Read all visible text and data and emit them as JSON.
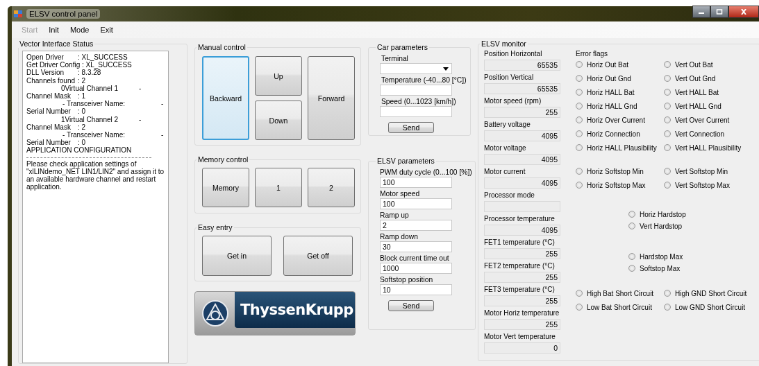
{
  "window": {
    "title": "ELSV control panel"
  },
  "menu": [
    {
      "label": "Start",
      "disabled": true
    },
    {
      "label": "Init",
      "disabled": false
    },
    {
      "label": "Mode",
      "disabled": false
    },
    {
      "label": "Exit",
      "disabled": false
    }
  ],
  "vector_status": {
    "title": "Vector Interface Status",
    "lines": [
      {
        "kind": "pair",
        "text": "Open Driver",
        "value": ": XL_SUCCESS"
      },
      {
        "kind": "plain",
        "text": "Get Driver Config : XL_SUCCESS"
      },
      {
        "kind": "pair",
        "text": "DLL Version",
        "value": ": 8.3.28"
      },
      {
        "kind": "pair",
        "text": "Channels found",
        "value": ": 2"
      },
      {
        "kind": "indented",
        "text": "0Virtual Channel 1",
        "tail": "-"
      },
      {
        "kind": "pair",
        "text": "Channel Mask",
        "value": ": 1"
      },
      {
        "kind": "indented2",
        "text": "- Transceiver Name:",
        "tail": "-"
      },
      {
        "kind": "pair",
        "text": "Serial Number",
        "value": ": 0"
      },
      {
        "kind": "indented",
        "text": "1Virtual Channel 2",
        "tail": "-"
      },
      {
        "kind": "pair",
        "text": "Channel Mask",
        "value": ": 2"
      },
      {
        "kind": "indented2",
        "text": "- Transceiver Name:",
        "tail": "-"
      },
      {
        "kind": "pair",
        "text": "Serial Number",
        "value": ": 0"
      },
      {
        "kind": "plain",
        "text": "APPLICATION CONFIGURATION"
      },
      {
        "kind": "rule"
      },
      {
        "kind": "plain",
        "text": "Please check application settings of \"xlLINdemo_NET LIN1/LIN2\" and assign it to an available hardware channel and restart application."
      }
    ]
  },
  "manual_control": {
    "title": "Manual control",
    "buttons": [
      {
        "label": "Backward",
        "focused": true
      },
      {
        "label": "Up",
        "focused": false
      },
      {
        "label": "Down",
        "focused": false
      },
      {
        "label": "Forward",
        "focused": false
      }
    ]
  },
  "memory_control": {
    "title": "Memory control",
    "buttons": [
      "Memory",
      "1",
      "2"
    ]
  },
  "easy_entry": {
    "title": "Easy entry",
    "buttons": [
      "Get in",
      "Get off"
    ]
  },
  "logo": {
    "text": "ThyssenKrupp"
  },
  "car_parameters": {
    "title": "Car parameters",
    "fields": [
      {
        "kind": "dropdown",
        "label": "Terminal"
      },
      {
        "kind": "text",
        "label": "Temperature (-40...80 [°C])"
      },
      {
        "kind": "text",
        "label": "Speed (0...1023 [km/h])"
      }
    ],
    "button": "Send"
  },
  "elsv_parameters": {
    "title": "ELSV parameters",
    "fields": [
      {
        "label": "PWM duty cycle (0...100 [%])",
        "value": "100"
      },
      {
        "label": "Motor speed",
        "value": "100"
      },
      {
        "label": "Ramp up",
        "value": "2"
      },
      {
        "label": "Ramp down",
        "value": "30"
      },
      {
        "label": "Block current time out",
        "value": "1000"
      },
      {
        "label": "Softstop position",
        "value": "10"
      }
    ],
    "button": "Send"
  },
  "elsv_monitor": {
    "title": "ELSV monitor",
    "fields": [
      {
        "label": "Position Horizontal",
        "value": "65535"
      },
      {
        "label": "Position Vertical",
        "value": "65535"
      },
      {
        "label": "Motor speed (rpm)",
        "value": "255"
      },
      {
        "label": "Battery voltage",
        "value": "4095"
      },
      {
        "label": "Motor voltage",
        "value": "4095"
      },
      {
        "label": "Motor current",
        "value": "4095"
      },
      {
        "label": "Processor mode"
      },
      {
        "label": "Processor temperature",
        "value": "4095"
      },
      {
        "label": "FET1 temperature (°C)",
        "value": "255"
      },
      {
        "label": "FET2 temperature (°C)",
        "value": "255"
      },
      {
        "label": "FET3 temperature (°C)",
        "value": "255"
      },
      {
        "label": "Motor Horiz temperature",
        "value": "255"
      },
      {
        "label": "Motor Vert temperature",
        "value": "0"
      }
    ],
    "error_flags": {
      "title": "Error flags",
      "groups": [
        {
          "kind": "pairs",
          "items": [
            {
              "label": "Horiz Out Bat",
              "checked": false
            },
            {
              "label": "Vert Out Bat",
              "checked": false
            },
            {
              "label": "Horiz Out Gnd",
              "checked": false
            },
            {
              "label": "Vert Out Gnd",
              "checked": false
            },
            {
              "label": "Horiz HALL Bat",
              "checked": false
            },
            {
              "label": "Vert HALL Bat",
              "checked": false
            },
            {
              "label": "Horiz HALL Gnd",
              "checked": false
            },
            {
              "label": "Vert HALL Gnd",
              "checked": false
            },
            {
              "label": "Horiz Over Current",
              "checked": false
            },
            {
              "label": "Vert Over Current",
              "checked": false
            },
            {
              "label": "Horiz Connection",
              "checked": false
            },
            {
              "label": "Vert Connection",
              "checked": false
            },
            {
              "label": "Horiz HALL Plausibility",
              "checked": false
            },
            {
              "label": "Vert HALL Plausibility",
              "checked": false
            }
          ]
        },
        {
          "kind": "pairs",
          "items": [
            {
              "label": "Horiz Softstop Min",
              "checked": false
            },
            {
              "label": "Vert Softstop Min",
              "checked": false
            },
            {
              "label": "Horiz Softstop Max",
              "checked": false
            },
            {
              "label": "Vert Softstop Max",
              "checked": false
            }
          ]
        },
        {
          "kind": "center",
          "items": [
            {
              "label": "Horiz Hardstop",
              "checked": false
            },
            {
              "label": "Vert Hardstop",
              "checked": false
            }
          ]
        },
        {
          "kind": "center",
          "items": [
            {
              "label": "Hardstop Max",
              "checked": false
            },
            {
              "label": "Softstop Max",
              "checked": false
            }
          ]
        },
        {
          "kind": "pairs",
          "items": [
            {
              "label": "High Bat Short Circuit",
              "checked": false
            },
            {
              "label": "High GND Short Circuit",
              "checked": false
            },
            {
              "label": "Low Bat Short Circuit",
              "checked": false
            },
            {
              "label": "Low GND Short Circuit",
              "checked": false
            }
          ]
        }
      ]
    }
  }
}
